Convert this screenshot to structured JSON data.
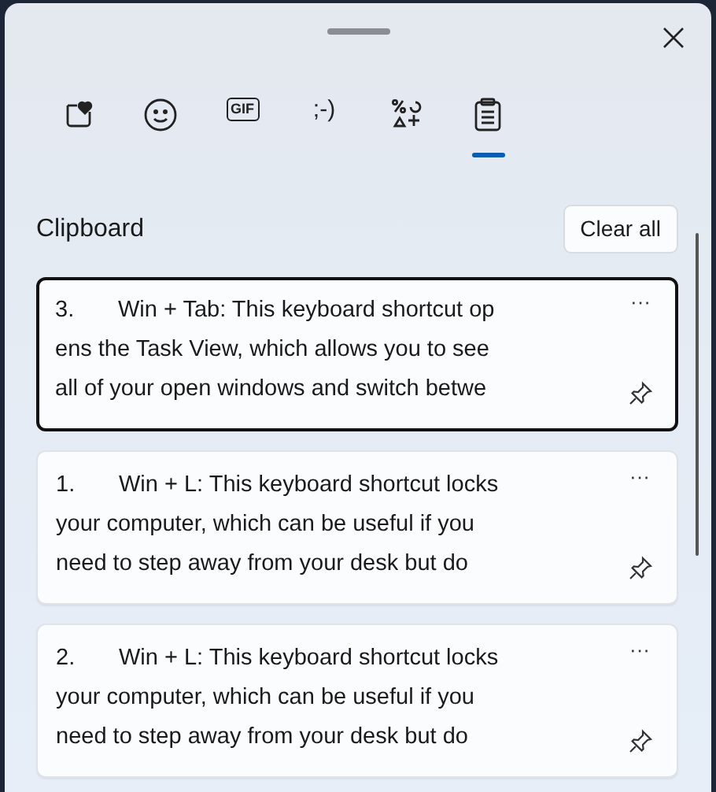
{
  "tabs": [
    {
      "kind": "favorites",
      "selected": false
    },
    {
      "kind": "emoji",
      "selected": false
    },
    {
      "kind": "gif",
      "label": "GIF",
      "selected": false
    },
    {
      "kind": "kaomoji",
      "label": ";-)",
      "selected": false
    },
    {
      "kind": "symbols",
      "selected": false
    },
    {
      "kind": "clipboard",
      "selected": true
    }
  ],
  "section_title": "Clipboard",
  "clear_button": "Clear all",
  "items": [
    {
      "number": "3.",
      "lines": [
        "Win + Tab: This keyboard shortcut op",
        "ens the Task View, which allows you to see",
        "all of your open windows and switch betwe"
      ],
      "selected": true,
      "menu": "···"
    },
    {
      "number": "1.",
      "lines": [
        "Win + L: This keyboard shortcut locks",
        "your computer, which can be useful if you",
        "need to step away from your desk but do"
      ],
      "selected": false,
      "menu": "···"
    },
    {
      "number": "2.",
      "lines": [
        "Win + L: This keyboard shortcut locks",
        "your computer, which can be useful if you",
        "need to step away from your desk but do"
      ],
      "selected": false,
      "menu": "···"
    }
  ]
}
